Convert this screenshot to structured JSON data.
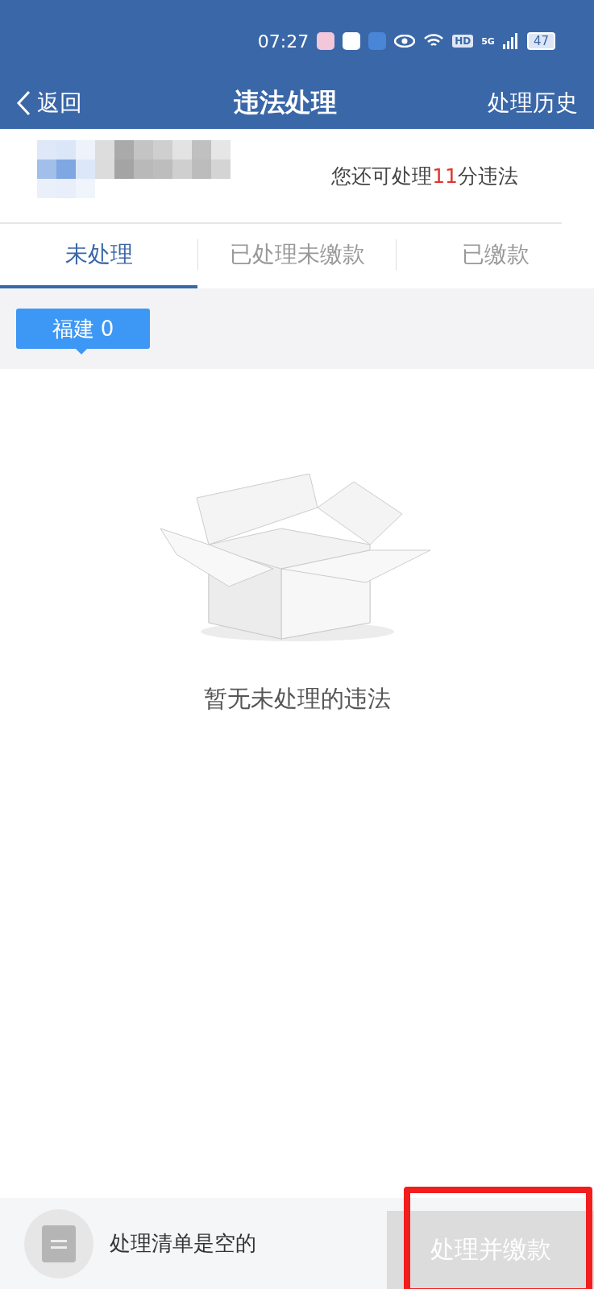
{
  "status_bar": {
    "time": "07:27",
    "network": "5G",
    "hd": "HD",
    "battery": "47"
  },
  "header": {
    "back": "返回",
    "title": "违法处理",
    "action": "处理历史"
  },
  "account": {
    "remaining": "您还可处理**11**分违法"
  },
  "tabs": [
    {
      "label": "未处理",
      "selected": true
    },
    {
      "label": "已处理未缴款",
      "selected": false
    },
    {
      "label": "已缴款",
      "selected": false
    }
  ],
  "regions": [
    {
      "label": "福建 0",
      "selected": true
    }
  ],
  "empty_state": {
    "message": "暂无未处理的违法"
  },
  "bottom_bar": {
    "cart_label": "处理清单是空的",
    "submit": {
      "label": "处理并缴款",
      "disabled": true
    },
    "highlighted": true
  }
}
